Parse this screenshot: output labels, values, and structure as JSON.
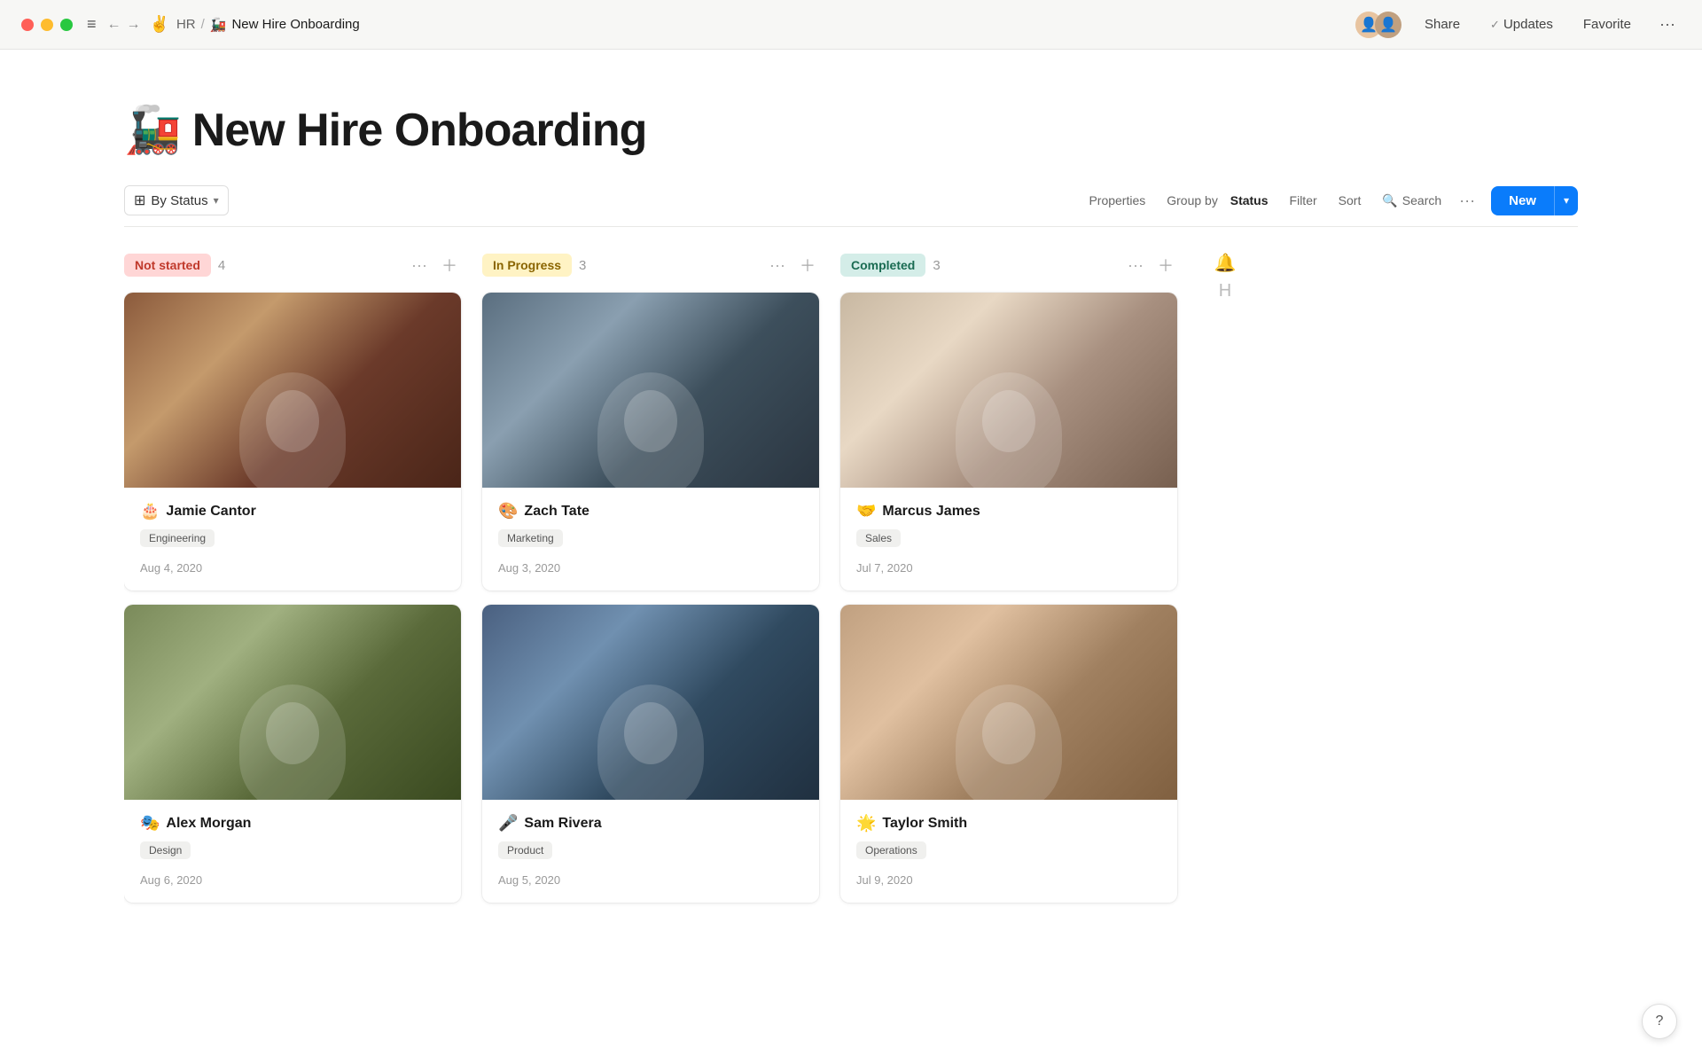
{
  "titlebar": {
    "breadcrumb_parent": "HR",
    "breadcrumb_separator": "/",
    "page_emoji": "🚂",
    "page_title": "New Hire Onboarding",
    "share_label": "Share",
    "updates_label": "Updates",
    "favorite_label": "Favorite"
  },
  "page": {
    "title_emoji": "🚂",
    "title_text": "New Hire Onboarding"
  },
  "toolbar": {
    "view_label": "By Status",
    "properties_label": "Properties",
    "group_by_prefix": "Group by",
    "group_by_value": "Status",
    "filter_label": "Filter",
    "sort_label": "Sort",
    "search_label": "Search",
    "new_label": "New"
  },
  "columns": [
    {
      "id": "not-started",
      "label": "Not started",
      "badge_class": "not-started",
      "count": 4
    },
    {
      "id": "in-progress",
      "label": "In Progress",
      "badge_class": "in-progress",
      "count": 3
    },
    {
      "id": "completed",
      "label": "Completed",
      "badge_class": "completed",
      "count": 3
    },
    {
      "id": "hidden",
      "label": "Hidden",
      "badge_class": "hidden",
      "count": null
    }
  ],
  "cards": {
    "not-started": [
      {
        "name": "Jamie Cantor",
        "emoji": "🎂",
        "tag": "Engineering",
        "date": "Aug 4, 2020",
        "photo_class": "photo-1"
      },
      {
        "name": "Alex Morgan",
        "emoji": "🎭",
        "tag": "Design",
        "date": "Aug 6, 2020",
        "photo_class": "photo-4"
      }
    ],
    "in-progress": [
      {
        "name": "Zach Tate",
        "emoji": "🎨",
        "tag": "Marketing",
        "date": "Aug 3, 2020",
        "photo_class": "photo-2"
      },
      {
        "name": "Sam Rivera",
        "emoji": "🎤",
        "tag": "Product",
        "date": "Aug 5, 2020",
        "photo_class": "photo-5"
      }
    ],
    "completed": [
      {
        "name": "Marcus James",
        "emoji": "🤝",
        "tag": "Sales",
        "date": "Jul 7, 2020",
        "photo_class": "photo-3"
      },
      {
        "name": "Taylor Smith",
        "emoji": "🌟",
        "tag": "Operations",
        "date": "Jul 9, 2020",
        "photo_class": "photo-6"
      }
    ]
  },
  "help": {
    "label": "?"
  }
}
